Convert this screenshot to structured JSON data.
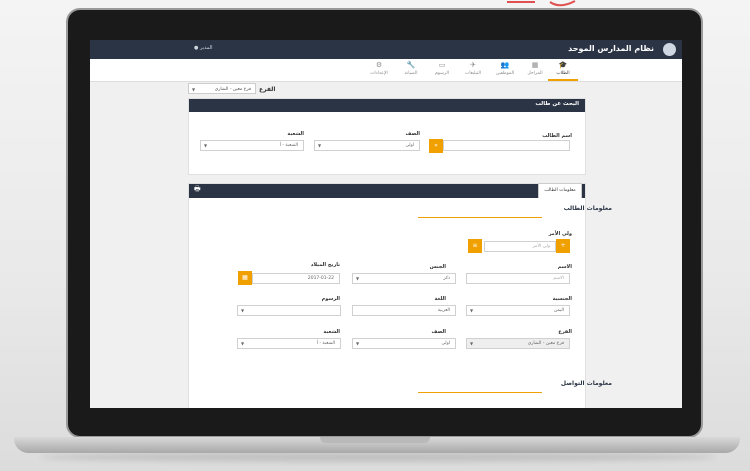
{
  "app": {
    "title": "نظام المدارس الموحد",
    "user_menu": "● المدير"
  },
  "nav": [
    {
      "label": "الطلاب",
      "icon": "🎓",
      "active": true
    },
    {
      "label": "المراحل",
      "icon": "▦"
    },
    {
      "label": "الموظفين",
      "icon": "👥"
    },
    {
      "label": "التبليغات",
      "icon": "✈"
    },
    {
      "label": "الرسوم",
      "icon": "▭"
    },
    {
      "label": "الصيانة",
      "icon": "🔧"
    },
    {
      "label": "الإعدادات",
      "icon": "⚙"
    }
  ],
  "branch": {
    "label": "الفرع",
    "value": "فرع معين - الشاري"
  },
  "search": {
    "title": "البحث عن طالب",
    "student_name_label": "اسم الطالب",
    "grade_label": "الصف",
    "grade_value": "اولى",
    "section_label": "الشعبة",
    "section_value": "الشعبة - أ",
    "search_icon": "»"
  },
  "info": {
    "tab": "معلومات الطالب",
    "section_title": "معلومات الطالب",
    "guardian_label": "ولي الأمر",
    "guardian_placeholder": "ولي الأمر",
    "name_label": "الاسم",
    "name_placeholder": "الاسم",
    "gender_label": "الجنس",
    "gender_value": "ذكر",
    "dob_label": "تاريخ الميلاد",
    "dob_value": "2017-01-22",
    "nationality_label": "الجنسية",
    "nationality_value": "اليمن",
    "language_label": "اللغة",
    "language_value": "العربية",
    "fees_label": "الرسوم",
    "branch_label": "الفرع",
    "branch_value": "فرع معين - الشاري",
    "grade_label": "الصف",
    "grade_value": "اولى",
    "section_label": "الشعبة",
    "section_value": "الشعبة - أ",
    "contact_title": "معلومات التواصل"
  }
}
